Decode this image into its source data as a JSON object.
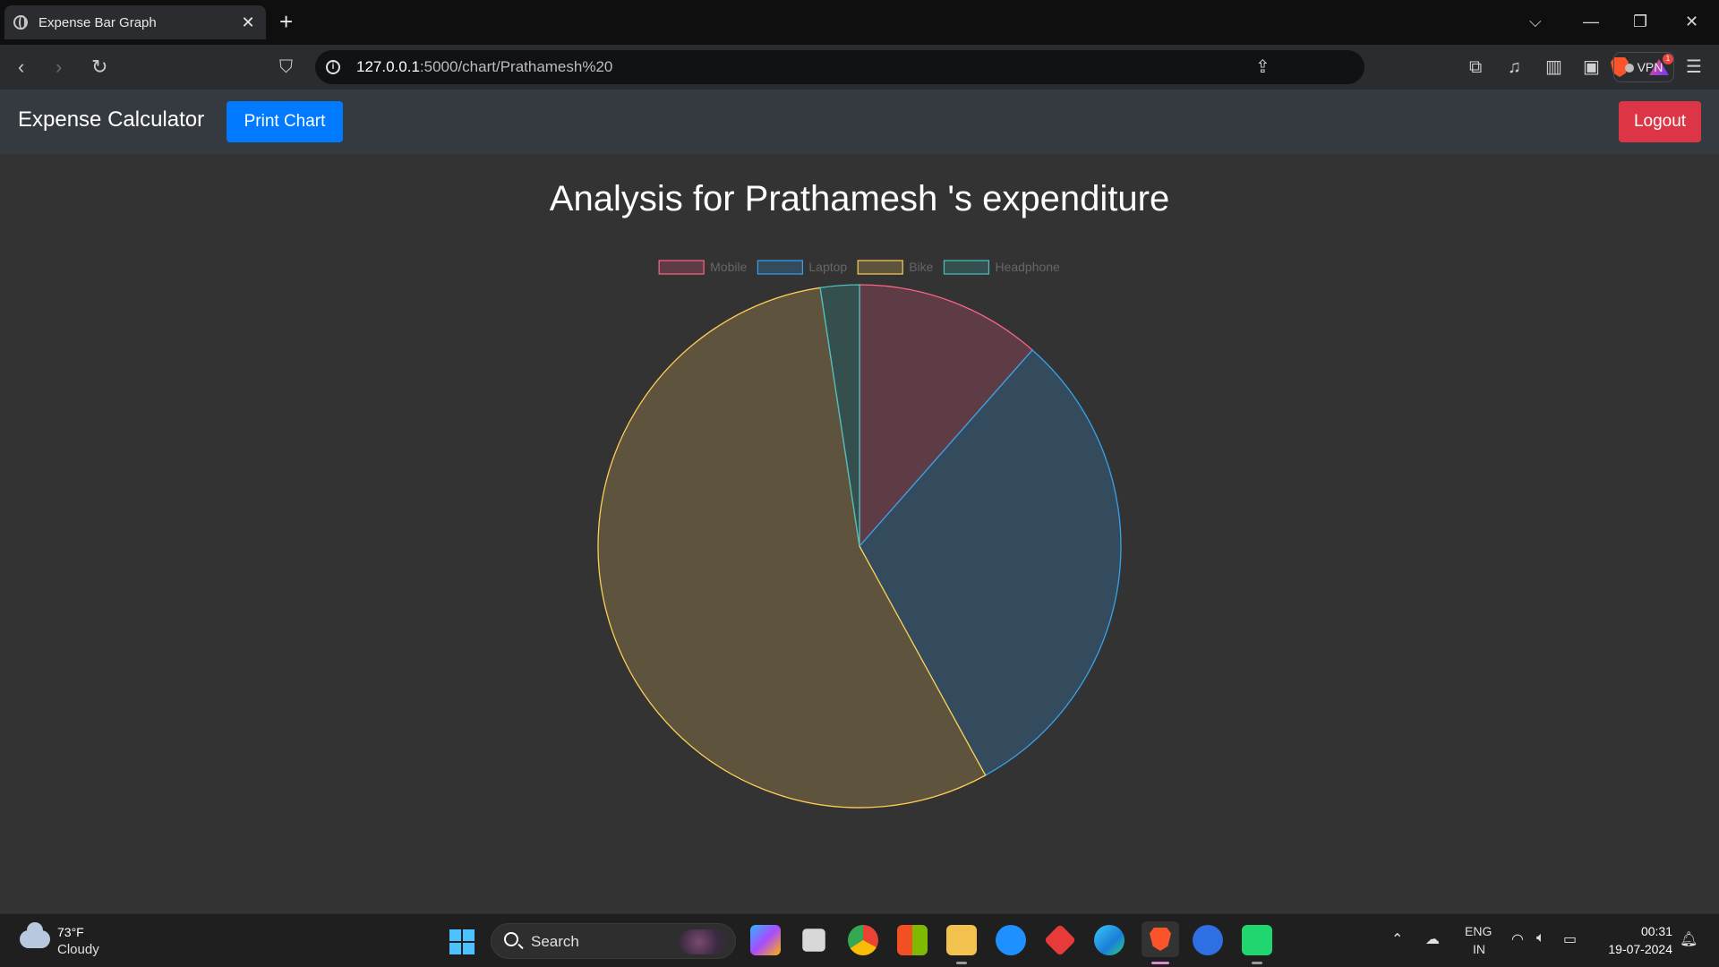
{
  "browser": {
    "tab_title": "Expense Bar Graph",
    "url_host": "127.0.0.1",
    "url_path": ":5000/chart/Prathamesh%20",
    "brave_badge_count": "1",
    "vpn_label": "VPN"
  },
  "app": {
    "brand": "Expense Calculator",
    "print_button": "Print Chart",
    "logout_button": "Logout"
  },
  "page": {
    "heading": "Analysis for Prathamesh 's expenditure"
  },
  "chart_data": {
    "type": "pie",
    "labels": [
      "Mobile",
      "Laptop",
      "Bike",
      "Headphone"
    ],
    "values": [
      11.5,
      30.5,
      55.6,
      2.4
    ],
    "border_colors": [
      "#ff6384",
      "#36a2eb",
      "#ffce56",
      "#4bc0c0"
    ],
    "fill_colors": [
      "#5e3c45",
      "#334b5c",
      "#5e533c",
      "#354f4f"
    ],
    "legend_position": "top",
    "legend_text_color": "#666666"
  },
  "taskbar": {
    "weather_temp": "73°F",
    "weather_desc": "Cloudy",
    "search_label": "Search",
    "lang_top": "ENG",
    "lang_bottom": "IN",
    "time": "00:31",
    "date": "19-07-2024"
  }
}
